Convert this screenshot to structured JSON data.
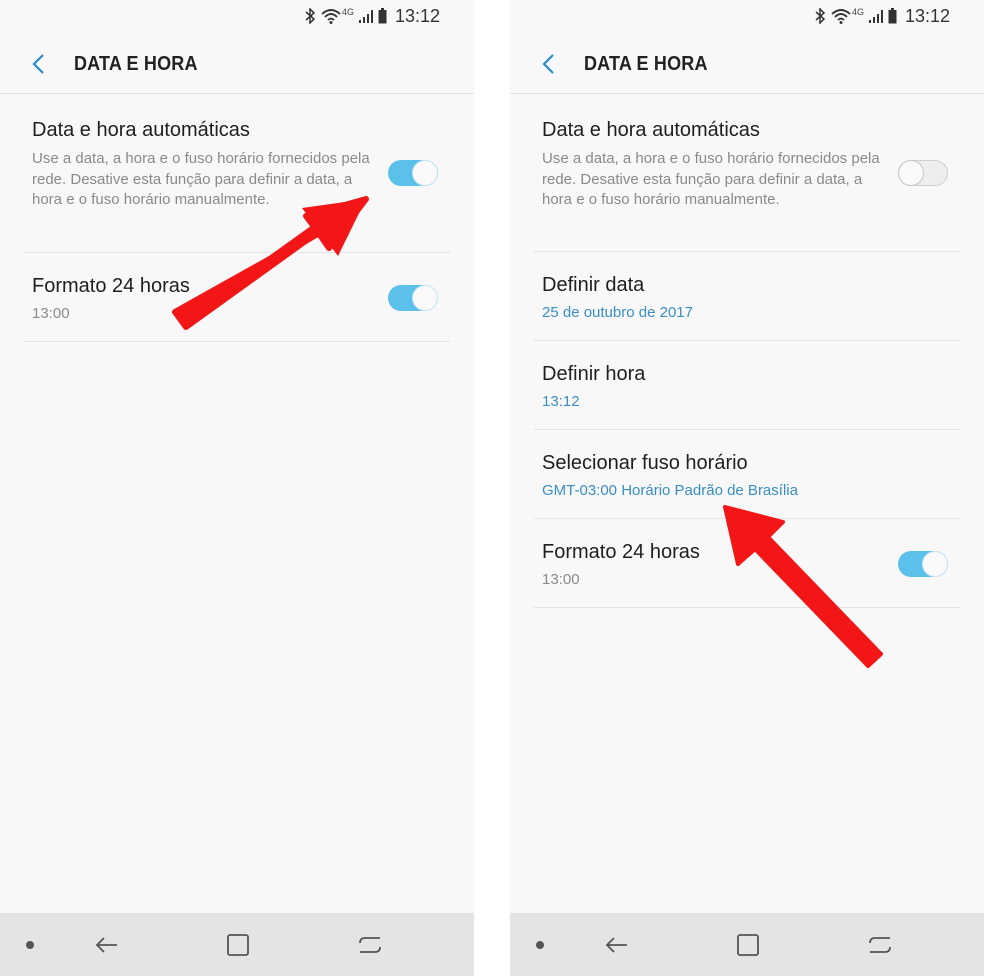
{
  "status_bar": {
    "time": "13:12",
    "network_label": "4G"
  },
  "header": {
    "title": "DATA E HORA"
  },
  "auto_datetime": {
    "title": "Data e hora automáticas",
    "description": "Use a data, a hora e o fuso horário fornecidos pela rede. Desative esta função para definir a data, a hora e o fuso horário manualmente."
  },
  "format24": {
    "title": "Formato 24 horas",
    "value": "13:00"
  },
  "set_date": {
    "title": "Definir data",
    "value": "25 de outubro de 2017"
  },
  "set_time": {
    "title": "Definir hora",
    "value": "13:12"
  },
  "timezone": {
    "title": "Selecionar fuso horário",
    "value": "GMT-03:00 Horário Padrão de Brasília"
  },
  "left_screen": {
    "auto_datetime_enabled": true,
    "format24_enabled": true
  },
  "right_screen": {
    "auto_datetime_enabled": false,
    "format24_enabled": true
  },
  "colors": {
    "accent": "#3a8fc4",
    "toggle_on": "#5bc0ea",
    "arrow": "#f21616"
  }
}
